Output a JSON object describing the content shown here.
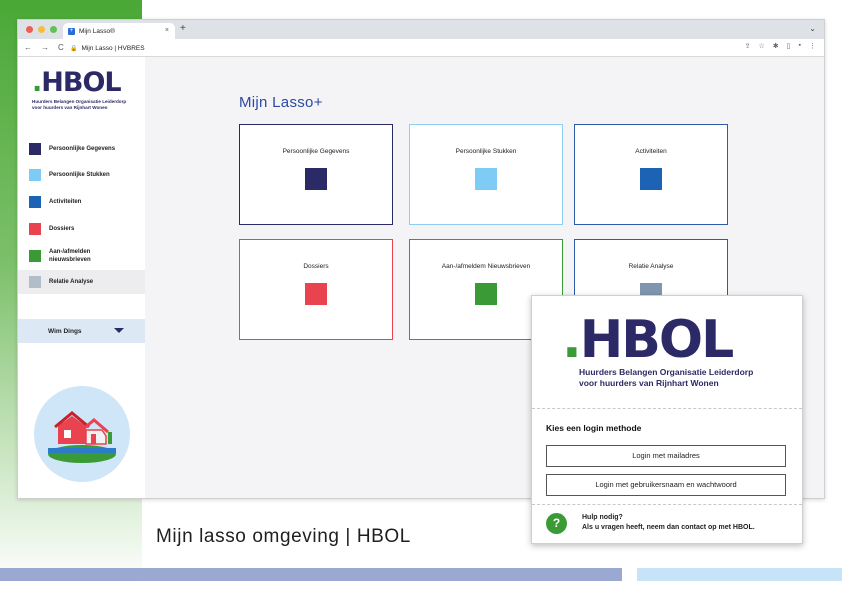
{
  "caption": "Mijn lasso omgeving | HBOL",
  "browser": {
    "tab_title": "Mijn Lasso®",
    "tab_close": "×",
    "new_tab": "+",
    "url": "Mijn Lasso | HVBRES"
  },
  "logo": {
    "dot": ".",
    "letters": "HBOL",
    "tagline_1": "Huurders Belangen Organisatie Leiderdorp",
    "tagline_2": "voor huurders van Rijnhart Wonen"
  },
  "sidebar": {
    "items": [
      {
        "label": "Persoonlijke Gegevens",
        "color": "#2c2a66"
      },
      {
        "label": "Persoonlijke Stukken",
        "color": "#7ecbf5"
      },
      {
        "label": "Activiteiten",
        "color": "#1d63b5"
      },
      {
        "label": "Dossiers",
        "color": "#e8434e"
      },
      {
        "label": "Aan-/afmelden nieuwsbrieven",
        "color": "#3a9b36"
      },
      {
        "label": "Relatie Analyse",
        "color": "#b2bdca"
      }
    ],
    "user": "Wim Dings"
  },
  "main": {
    "title": "Mijn Lasso+",
    "cards": [
      {
        "label": "Persoonlijke Gegevens",
        "color": "#2c2a66",
        "border": "#2c2a66"
      },
      {
        "label": "Persoonlijke Stukken",
        "color": "#7ecbf5",
        "border": "#8fcdf2"
      },
      {
        "label": "Activiteiten",
        "color": "#1d63b5",
        "border": "#2f5aa8"
      },
      {
        "label": "Dossiers",
        "color": "#e8434e",
        "border": "#e8434e"
      },
      {
        "label": "Aan-/afmeldem Nieuwsbrieven",
        "color": "#3a9b36",
        "border": "#3a9b36"
      },
      {
        "label": "Relatie Analyse",
        "color": "#7f96ae",
        "border": "#2f5aa8"
      }
    ]
  },
  "login": {
    "heading": "Kies een login methode",
    "button_mail": "Login met mailadres",
    "button_user": "Login met gebruikersnaam en wachtwoord",
    "help_title": "Hulp nodig?",
    "help_text": "Als u vragen heeft, neem dan contact op met HBOL.",
    "help_glyph": "?"
  }
}
